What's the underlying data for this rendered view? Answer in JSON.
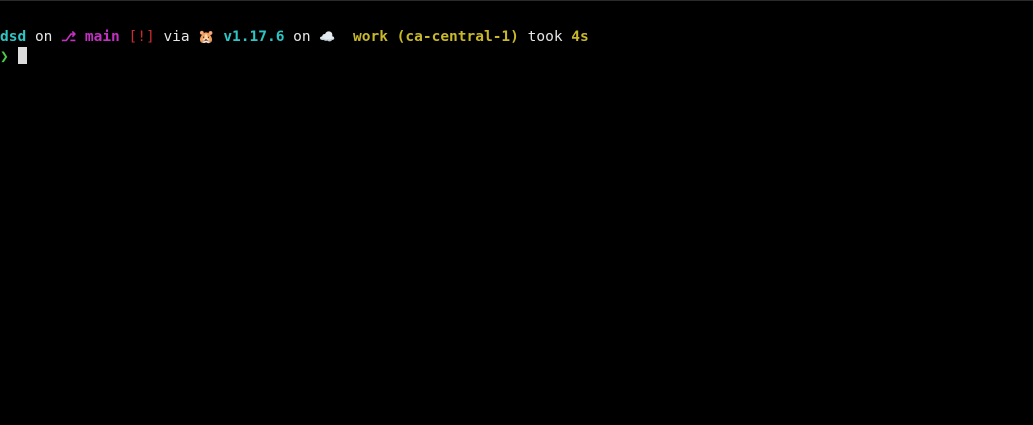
{
  "prompt": {
    "directory": "dsd",
    "on_1": "on",
    "branch_icon": "⎇",
    "branch": "main",
    "git_status": "[!]",
    "via": "via",
    "gopher_icon": "🐹",
    "version": "v1.17.6",
    "on_2": "on",
    "cloud_icon": "☁️",
    "aws_profile": "work (ca-central-1)",
    "took": "took",
    "duration": "4s",
    "prompt_char": "❯"
  },
  "colors": {
    "background": "#000000",
    "directory": "#2ec5c5",
    "branch": "#c330c3",
    "git_status": "#cc2b2b",
    "version": "#2ec5c5",
    "aws": "#c8b82a",
    "duration": "#c8b82a",
    "prompt_char": "#4ac94a",
    "cursor": "#dcdcdc"
  }
}
